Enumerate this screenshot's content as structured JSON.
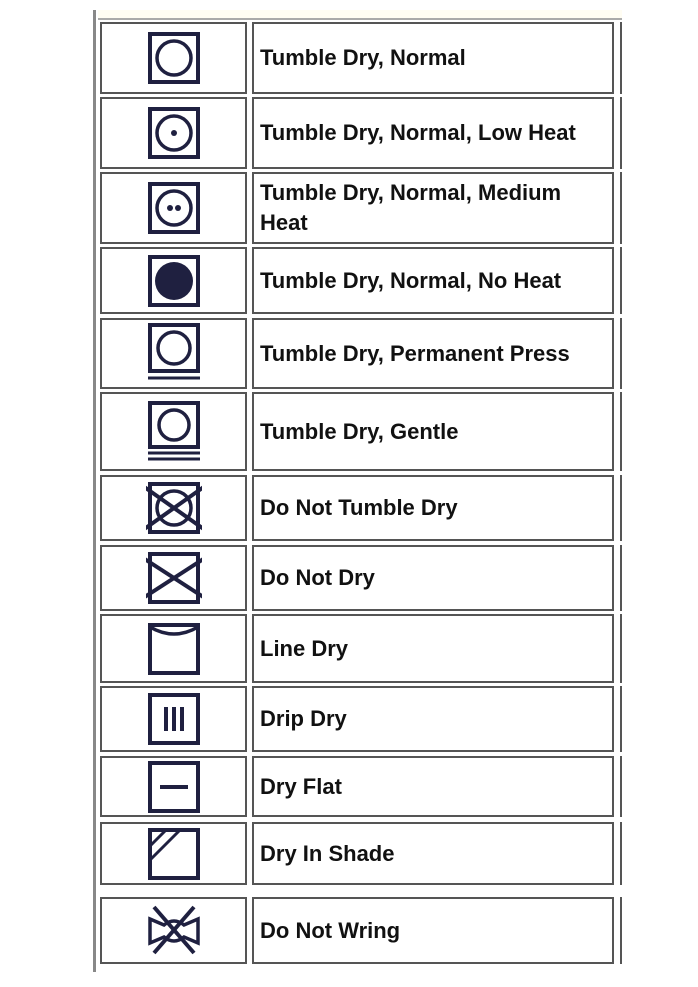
{
  "colors": {
    "symbol": "#1f2040",
    "border": "#555555"
  },
  "rows": [
    {
      "icon": "tumble-dry-normal-icon",
      "label": "Tumble Dry, Normal"
    },
    {
      "icon": "tumble-dry-low-heat-icon",
      "label": "Tumble Dry, Normal, Low Heat"
    },
    {
      "icon": "tumble-dry-medium-heat-icon",
      "label": "Tumble Dry, Normal, Medium Heat"
    },
    {
      "icon": "tumble-dry-no-heat-icon",
      "label": "Tumble Dry, Normal, No Heat"
    },
    {
      "icon": "tumble-dry-permanent-press-icon",
      "label": "Tumble Dry, Permanent Press"
    },
    {
      "icon": "tumble-dry-gentle-icon",
      "label": "Tumble Dry, Gentle"
    },
    {
      "icon": "do-not-tumble-dry-icon",
      "label": "Do Not Tumble Dry"
    },
    {
      "icon": "do-not-dry-icon",
      "label": "Do Not Dry"
    },
    {
      "icon": "line-dry-icon",
      "label": "Line Dry"
    },
    {
      "icon": "drip-dry-icon",
      "label": "Drip Dry"
    },
    {
      "icon": "dry-flat-icon",
      "label": "Dry Flat"
    },
    {
      "icon": "dry-in-shade-icon",
      "label": "Dry In Shade"
    },
    {
      "icon": "do-not-wring-icon",
      "label": "Do Not Wring"
    }
  ]
}
